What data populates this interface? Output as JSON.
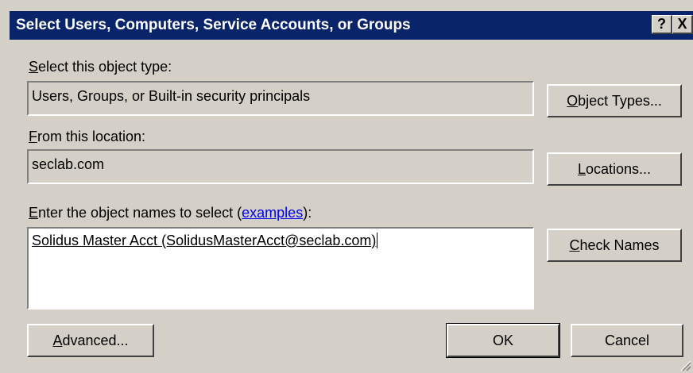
{
  "window": {
    "title": "Select Users, Computers, Service Accounts, or Groups",
    "help_btn": "?",
    "close_btn": "X"
  },
  "object_type": {
    "label_hot": "S",
    "label_rest": "elect this object type:",
    "value": "Users, Groups, or Built-in security principals",
    "button_hot": "O",
    "button_rest": "bject Types..."
  },
  "location": {
    "label_hot": "F",
    "label_rest": "rom this location:",
    "value": "seclab.com",
    "button_hot": "L",
    "button_rest": "ocations..."
  },
  "names": {
    "label_hot": "E",
    "label_rest": "nter the object names to select (",
    "link": "examples",
    "label_end": "):",
    "value": "Solidus Master Acct (SolidusMasterAcct@seclab.com)",
    "check_hot": "C",
    "check_rest": "heck Names"
  },
  "footer": {
    "advanced_hot": "A",
    "advanced_rest": "dvanced...",
    "ok": "OK",
    "cancel": "Cancel"
  }
}
